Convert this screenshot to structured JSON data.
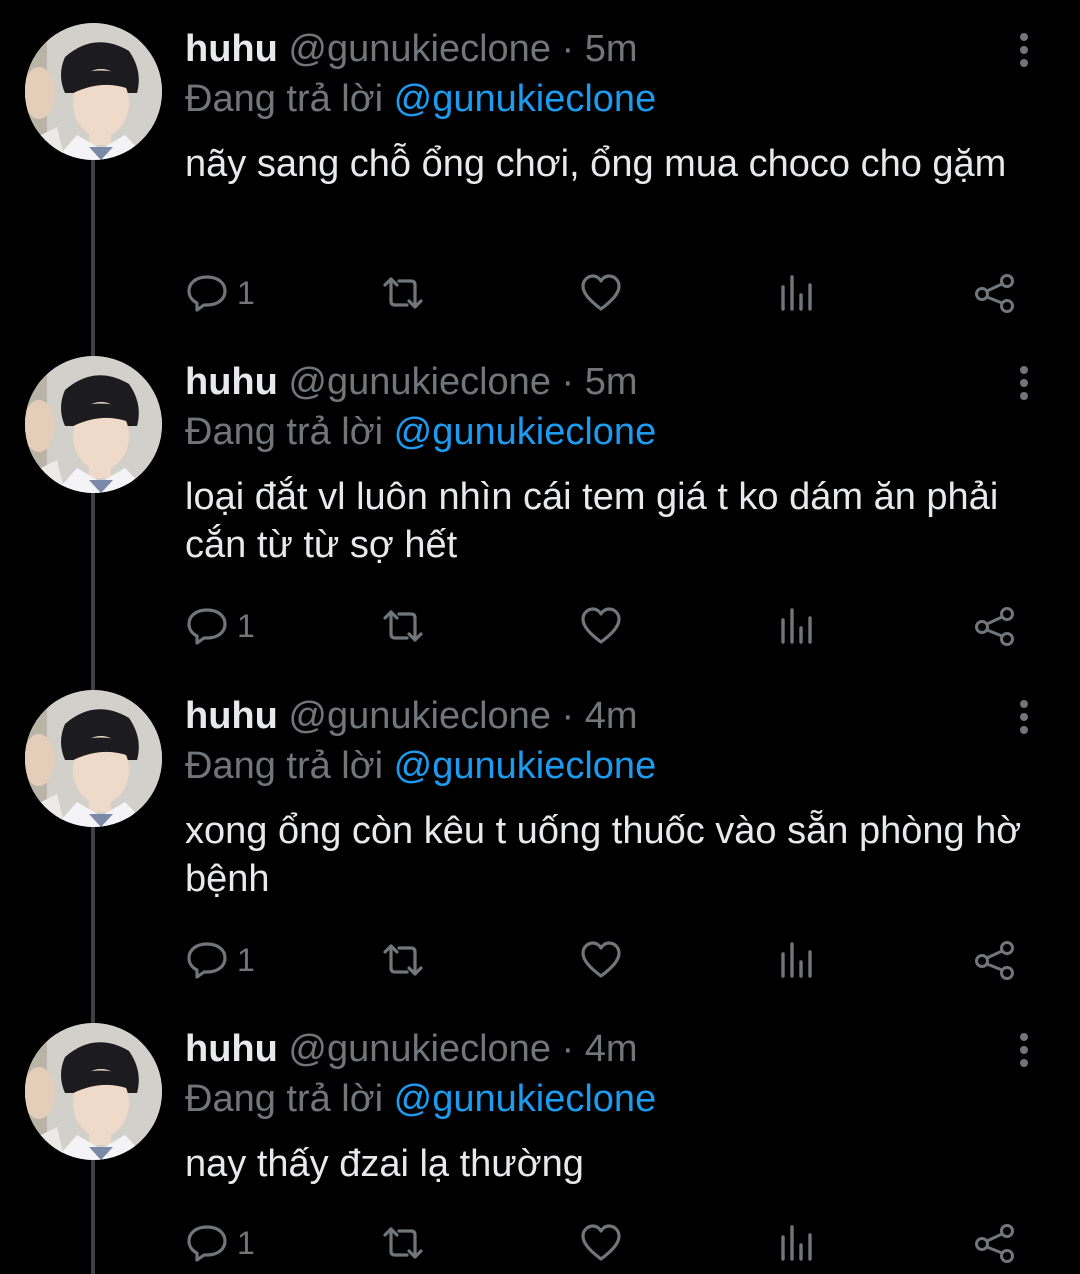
{
  "colors": {
    "background": "#000000",
    "text": "#e7e9ea",
    "muted": "#71767b",
    "accent": "#1d9bf0",
    "thread_line": "#3e4144"
  },
  "icons": {
    "reply": "reply-icon",
    "retweet": "retweet-icon",
    "like": "heart-icon",
    "views": "views-icon",
    "share": "share-icon",
    "more": "more-vertical-icon"
  },
  "tweets": [
    {
      "name": "huhu",
      "handle": "@gunukieclone",
      "separator": "·",
      "time": "5m",
      "reply_prefix": "Đang trả lời",
      "reply_to": "@gunukieclone",
      "text": "nãy sang chỗ ổng chơi, ổng mua choco cho gặm",
      "reply_count": "1"
    },
    {
      "name": "huhu",
      "handle": "@gunukieclone",
      "separator": "·",
      "time": "5m",
      "reply_prefix": "Đang trả lời",
      "reply_to": "@gunukieclone",
      "text": "loại đắt vl luôn nhìn cái tem giá t ko dám ăn phải cắn từ từ sợ hết",
      "reply_count": "1"
    },
    {
      "name": "huhu",
      "handle": "@gunukieclone",
      "separator": "·",
      "time": "4m",
      "reply_prefix": "Đang trả lời",
      "reply_to": "@gunukieclone",
      "text": "xong ổng còn kêu t uống thuốc vào sẵn phòng hờ bệnh",
      "reply_count": "1"
    },
    {
      "name": "huhu",
      "handle": "@gunukieclone",
      "separator": "·",
      "time": "4m",
      "reply_prefix": "Đang trả lời",
      "reply_to": "@gunukieclone",
      "text": "nay thấy đzai lạ thường",
      "reply_count": "1"
    }
  ]
}
